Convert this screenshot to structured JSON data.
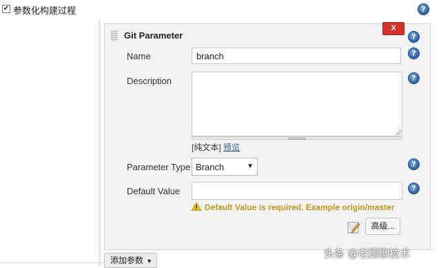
{
  "section": {
    "checkbox_checked": true,
    "label": "参数化构建过程"
  },
  "param": {
    "title": "Git Parameter",
    "delete_label": "X",
    "name_label": "Name",
    "name_value": "branch",
    "description_label": "Description",
    "description_value": "",
    "text_format_prefix": "[纯文本]",
    "preview_link": "预览",
    "type_label": "Parameter Type",
    "type_selected": "Branch",
    "default_label": "Default Value",
    "default_value": "",
    "warning": "Default Value is required. Example origin/master",
    "advanced_label": "高级...",
    "help_glyph": "?"
  },
  "footer": {
    "add_param_label": "添加参数"
  },
  "watermark": "头条 @老顾聊技术",
  "colors": {
    "delete_button": "#d3322c",
    "warning_text": "#c6981a",
    "link": "#3b5fa0",
    "help_icon": "#2d62a8"
  },
  "icons": {
    "help": "question-mark-circle-icon",
    "warning": "warning-triangle-icon",
    "notepad": "notepad-pencil-icon",
    "dropdown": "chevron-down-icon"
  }
}
